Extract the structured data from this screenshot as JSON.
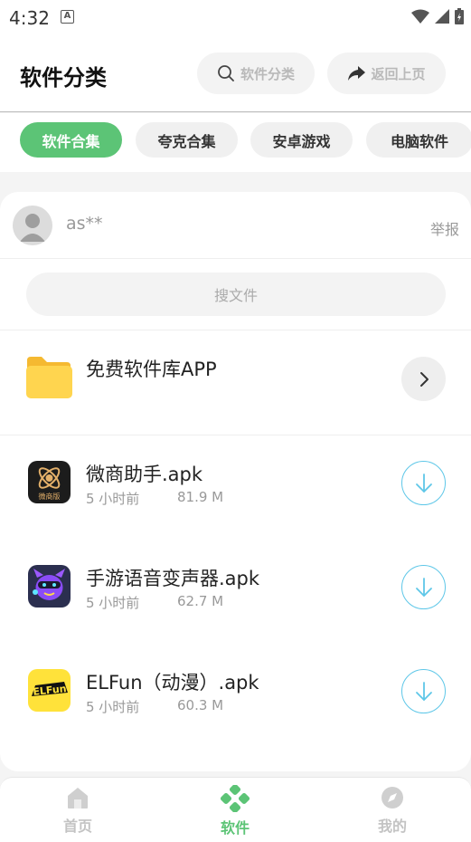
{
  "status_bar": {
    "time": "4:32",
    "notification_icon": "a-letter-icon",
    "icons": [
      "wifi-icon",
      "signal-icon",
      "battery-icon"
    ]
  },
  "header": {
    "title": "软件分类",
    "search_label": "软件分类",
    "back_label": "返回上页"
  },
  "tabs": [
    {
      "label": "软件合集",
      "active": true
    },
    {
      "label": "夸克合集",
      "active": false
    },
    {
      "label": "安卓游戏",
      "active": false
    },
    {
      "label": "电脑软件",
      "active": false
    }
  ],
  "uploader": {
    "name": "as**",
    "report_label": "举报"
  },
  "search": {
    "placeholder": "搜文件"
  },
  "folder": {
    "name": "免费软件库APP"
  },
  "files": [
    {
      "name": "微商助手.apk",
      "time": "5 小时前",
      "size": "81.9 M",
      "icon": "weishang-app-icon",
      "icon_text": "微商版"
    },
    {
      "name": "手游语音变声器.apk",
      "time": "5 小时前",
      "size": "62.7 M",
      "icon": "voice-changer-app-icon"
    },
    {
      "name": "ELFun（动漫）.apk",
      "time": "5 小时前",
      "size": "60.3 M",
      "icon": "elfun-app-icon",
      "icon_text": "ELFun"
    }
  ],
  "bottom_nav": [
    {
      "label": "首页",
      "icon": "home-icon",
      "active": false
    },
    {
      "label": "软件",
      "icon": "apps-icon",
      "active": true
    },
    {
      "label": "我的",
      "icon": "compass-icon",
      "active": false
    }
  ],
  "colors": {
    "accent": "#5cc476",
    "download": "#5ec7e8",
    "folder": "#ffd54f"
  }
}
